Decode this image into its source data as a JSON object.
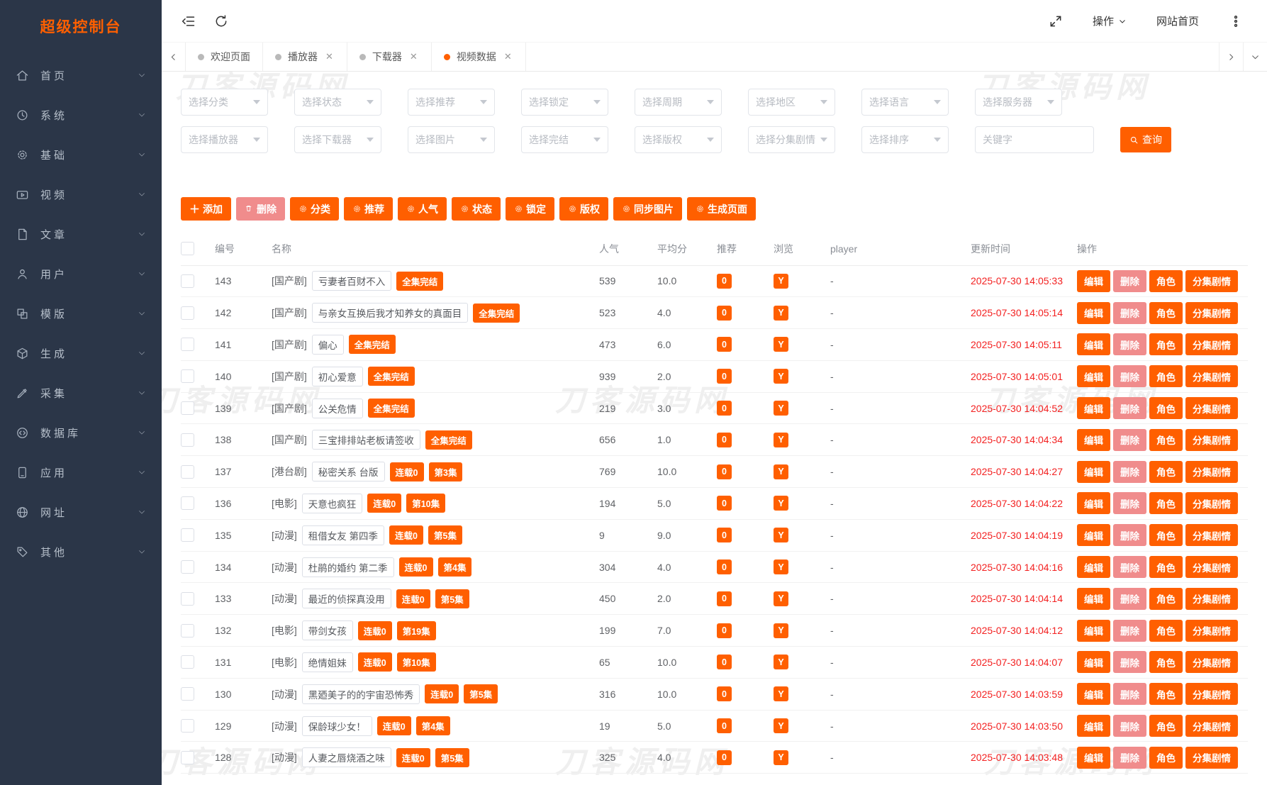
{
  "app": {
    "title": "超级控制台"
  },
  "watermark": {
    "text": "刀客源码网"
  },
  "sidebar": {
    "items": [
      {
        "label": "首页",
        "icon": "home-icon"
      },
      {
        "label": "系统",
        "icon": "system-icon"
      },
      {
        "label": "基础",
        "icon": "gear-icon"
      },
      {
        "label": "视频",
        "icon": "video-icon"
      },
      {
        "label": "文章",
        "icon": "article-icon"
      },
      {
        "label": "用户",
        "icon": "user-icon"
      },
      {
        "label": "模版",
        "icon": "template-icon"
      },
      {
        "label": "生成",
        "icon": "cube-icon"
      },
      {
        "label": "采集",
        "icon": "pen-icon"
      },
      {
        "label": "数据库",
        "icon": "database-icon"
      },
      {
        "label": "应用",
        "icon": "app-icon"
      },
      {
        "label": "网址",
        "icon": "globe-icon"
      },
      {
        "label": "其他",
        "icon": "tag-icon"
      }
    ]
  },
  "topbar": {
    "actions_label": "操作",
    "site_home_label": "网站首页"
  },
  "tabs": [
    {
      "label": "欢迎页面",
      "closable": false,
      "active": false
    },
    {
      "label": "播放器",
      "closable": true,
      "active": false
    },
    {
      "label": "下载器",
      "closable": true,
      "active": false
    },
    {
      "label": "视频数据",
      "closable": true,
      "active": true
    }
  ],
  "filters": {
    "row1": [
      "选择分类",
      "选择状态",
      "选择推荐",
      "选择锁定",
      "选择周期",
      "选择地区",
      "选择语言",
      "选择服务器"
    ],
    "row2": [
      "选择播放器",
      "选择下载器",
      "选择图片",
      "选择完结",
      "选择版权",
      "选择分集剧情",
      "选择排序"
    ],
    "keyword_placeholder": "关键字",
    "search_label": "查询"
  },
  "toolbar": [
    {
      "label": "添加",
      "icon": "plus-icon",
      "variant": "primary"
    },
    {
      "label": "删除",
      "icon": "trash-icon",
      "variant": "danger"
    },
    {
      "label": "分类",
      "icon": "gear-icon",
      "variant": "primary"
    },
    {
      "label": "推荐",
      "icon": "gear-icon",
      "variant": "primary"
    },
    {
      "label": "人气",
      "icon": "gear-icon",
      "variant": "primary"
    },
    {
      "label": "状态",
      "icon": "gear-icon",
      "variant": "primary"
    },
    {
      "label": "锁定",
      "icon": "gear-icon",
      "variant": "primary"
    },
    {
      "label": "版权",
      "icon": "gear-icon",
      "variant": "primary"
    },
    {
      "label": "同步图片",
      "icon": "gear-icon",
      "variant": "primary"
    },
    {
      "label": "生成页面",
      "icon": "gear-icon",
      "variant": "primary"
    }
  ],
  "table": {
    "columns": [
      "编号",
      "名称",
      "人气",
      "平均分",
      "推荐",
      "浏览",
      "player",
      "更新时间",
      "操作"
    ],
    "row_actions": [
      {
        "label": "编辑",
        "variant": "primary"
      },
      {
        "label": "删除",
        "variant": "danger"
      },
      {
        "label": "角色",
        "variant": "primary"
      },
      {
        "label": "分集剧情",
        "variant": "primary"
      }
    ],
    "rows": [
      {
        "id": "143",
        "category": "[国产剧]",
        "title": "亏妻者百财不入",
        "badges": [
          "全集完结"
        ],
        "popularity": "539",
        "score": "10.0",
        "recommend": "0",
        "browse": "Y",
        "player": "-",
        "updated": "2025-07-30 14:05:33"
      },
      {
        "id": "142",
        "category": "[国产剧]",
        "title": "与亲女互换后我才知养女的真面目",
        "badges": [
          "全集完结"
        ],
        "popularity": "523",
        "score": "4.0",
        "recommend": "0",
        "browse": "Y",
        "player": "-",
        "updated": "2025-07-30 14:05:14"
      },
      {
        "id": "141",
        "category": "[国产剧]",
        "title": "偏心",
        "badges": [
          "全集完结"
        ],
        "popularity": "473",
        "score": "6.0",
        "recommend": "0",
        "browse": "Y",
        "player": "-",
        "updated": "2025-07-30 14:05:11"
      },
      {
        "id": "140",
        "category": "[国产剧]",
        "title": "初心爱意",
        "badges": [
          "全集完结"
        ],
        "popularity": "939",
        "score": "2.0",
        "recommend": "0",
        "browse": "Y",
        "player": "-",
        "updated": "2025-07-30 14:05:01"
      },
      {
        "id": "139",
        "category": "[国产剧]",
        "title": "公关危情",
        "badges": [
          "全集完结"
        ],
        "popularity": "219",
        "score": "3.0",
        "recommend": "0",
        "browse": "Y",
        "player": "-",
        "updated": "2025-07-30 14:04:52"
      },
      {
        "id": "138",
        "category": "[国产剧]",
        "title": "三宝排排站老板请签收",
        "badges": [
          "全集完结"
        ],
        "popularity": "656",
        "score": "1.0",
        "recommend": "0",
        "browse": "Y",
        "player": "-",
        "updated": "2025-07-30 14:04:34"
      },
      {
        "id": "137",
        "category": "[港台剧]",
        "title": "秘密关系 台版",
        "badges": [
          "连载0",
          "第3集"
        ],
        "popularity": "769",
        "score": "10.0",
        "recommend": "0",
        "browse": "Y",
        "player": "-",
        "updated": "2025-07-30 14:04:27"
      },
      {
        "id": "136",
        "category": "[电影]",
        "title": "天意也疯狂",
        "badges": [
          "连载0",
          "第10集"
        ],
        "popularity": "194",
        "score": "5.0",
        "recommend": "0",
        "browse": "Y",
        "player": "-",
        "updated": "2025-07-30 14:04:22"
      },
      {
        "id": "135",
        "category": "[动漫]",
        "title": "租借女友 第四季",
        "badges": [
          "连载0",
          "第5集"
        ],
        "popularity": "9",
        "score": "9.0",
        "recommend": "0",
        "browse": "Y",
        "player": "-",
        "updated": "2025-07-30 14:04:19"
      },
      {
        "id": "134",
        "category": "[动漫]",
        "title": "杜鹃的婚约 第二季",
        "badges": [
          "连载0",
          "第4集"
        ],
        "popularity": "304",
        "score": "4.0",
        "recommend": "0",
        "browse": "Y",
        "player": "-",
        "updated": "2025-07-30 14:04:16"
      },
      {
        "id": "133",
        "category": "[动漫]",
        "title": "最近的侦探真没用",
        "badges": [
          "连载0",
          "第5集"
        ],
        "popularity": "450",
        "score": "2.0",
        "recommend": "0",
        "browse": "Y",
        "player": "-",
        "updated": "2025-07-30 14:04:14"
      },
      {
        "id": "132",
        "category": "[电影]",
        "title": "带剑女孩",
        "badges": [
          "连载0",
          "第19集"
        ],
        "popularity": "199",
        "score": "7.0",
        "recommend": "0",
        "browse": "Y",
        "player": "-",
        "updated": "2025-07-30 14:04:12"
      },
      {
        "id": "131",
        "category": "[电影]",
        "title": "绝情姐妹",
        "badges": [
          "连载0",
          "第10集"
        ],
        "popularity": "65",
        "score": "10.0",
        "recommend": "0",
        "browse": "Y",
        "player": "-",
        "updated": "2025-07-30 14:04:07"
      },
      {
        "id": "130",
        "category": "[动漫]",
        "title": "黑廼美子的的宇宙恐怖秀",
        "badges": [
          "连载0",
          "第5集"
        ],
        "popularity": "316",
        "score": "10.0",
        "recommend": "0",
        "browse": "Y",
        "player": "-",
        "updated": "2025-07-30 14:03:59"
      },
      {
        "id": "129",
        "category": "[动漫]",
        "title": "保龄球少女！",
        "badges": [
          "连载0",
          "第4集"
        ],
        "popularity": "19",
        "score": "5.0",
        "recommend": "0",
        "browse": "Y",
        "player": "-",
        "updated": "2025-07-30 14:03:50"
      },
      {
        "id": "128",
        "category": "[动漫]",
        "title": "人妻之唇烧酒之味",
        "badges": [
          "连载0",
          "第5集"
        ],
        "popularity": "325",
        "score": "4.0",
        "recommend": "0",
        "browse": "Y",
        "player": "-",
        "updated": "2025-07-30 14:03:48"
      }
    ]
  },
  "colors": {
    "primary": "#ff5f00",
    "danger_soft": "#f08c8c",
    "time_red": "#f32121",
    "sidebar_bg": "#2b3648"
  }
}
